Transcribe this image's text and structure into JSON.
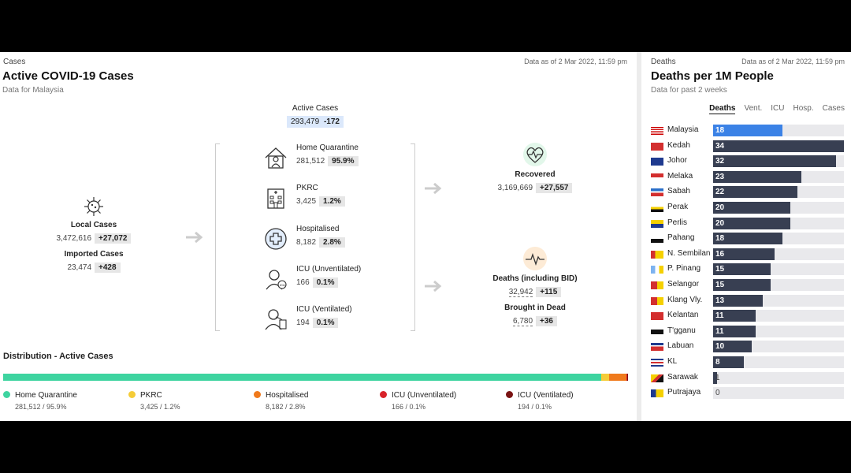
{
  "left_panel": {
    "section_label": "Cases",
    "timestamp": "Data as of 2 Mar 2022, 11:59 pm",
    "title": "Active COVID-19 Cases",
    "subtitle": "Data for Malaysia",
    "active_cases": {
      "label": "Active Cases",
      "value": "293,479",
      "delta": "-172"
    },
    "local_cases": {
      "label": "Local Cases",
      "value": "3,472,616",
      "delta": "+27,072"
    },
    "imported_cases": {
      "label": "Imported Cases",
      "value": "23,474",
      "delta": "+428"
    },
    "categories": [
      {
        "label": "Home Quarantine",
        "value": "281,512",
        "pct": "95.9%",
        "icon": "home-quarantine-icon"
      },
      {
        "label": "PKRC",
        "value": "3,425",
        "pct": "1.2%",
        "icon": "pkrc-building-icon"
      },
      {
        "label": "Hospitalised",
        "value": "8,182",
        "pct": "2.8%",
        "icon": "hospital-cross-icon"
      },
      {
        "label": "ICU (Unventilated)",
        "value": "166",
        "pct": "0.1%",
        "icon": "icu-doctor-icon"
      },
      {
        "label": "ICU (Ventilated)",
        "value": "194",
        "pct": "0.1%",
        "icon": "icu-ventilator-icon"
      }
    ],
    "recovered": {
      "label": "Recovered",
      "value": "3,169,669",
      "delta": "+27,557",
      "icon": "heartbeat-icon"
    },
    "deaths": {
      "label": "Deaths (including BID)",
      "value": "32,942",
      "delta": "+115",
      "icon": "pulse-icon"
    },
    "bid": {
      "label": "Brought in Dead",
      "value": "6,780",
      "delta": "+36"
    },
    "distribution": {
      "title": "Distribution - Active Cases",
      "segments": [
        {
          "name": "Home Quarantine",
          "text": "281,512 / 95.9%",
          "pct": 95.9,
          "color": "#3ed4a0"
        },
        {
          "name": "PKRC",
          "text": "3,425 / 1.2%",
          "pct": 1.2,
          "color": "#f5cc38"
        },
        {
          "name": "Hospitalised",
          "text": "8,182 / 2.8%",
          "pct": 2.8,
          "color": "#f07a1c"
        },
        {
          "name": "ICU (Unventilated)",
          "text": "166 / 0.1%",
          "pct": 0.1,
          "color": "#d8232a"
        },
        {
          "name": "ICU (Ventilated)",
          "text": "194 / 0.1%",
          "pct": 0.1,
          "color": "#7a1414"
        }
      ]
    }
  },
  "right_panel": {
    "section_label": "Deaths",
    "timestamp": "Data as of 2 Mar 2022, 11:59 pm",
    "title": "Deaths per 1M People",
    "subtitle": "Data for past 2 weeks",
    "tabs": [
      "Deaths",
      "Vent.",
      "ICU",
      "Hosp.",
      "Cases"
    ],
    "active_tab": "Deaths",
    "max_value": 34,
    "highlight_color": "#3b82e6",
    "bar_color": "#383f52",
    "states": [
      {
        "name": "Malaysia",
        "value": 18
      },
      {
        "name": "Kedah",
        "value": 34
      },
      {
        "name": "Johor",
        "value": 32
      },
      {
        "name": "Melaka",
        "value": 23
      },
      {
        "name": "Sabah",
        "value": 22
      },
      {
        "name": "Perak",
        "value": 20
      },
      {
        "name": "Perlis",
        "value": 20
      },
      {
        "name": "Pahang",
        "value": 18
      },
      {
        "name": "N. Sembilan",
        "value": 16
      },
      {
        "name": "P. Pinang",
        "value": 15
      },
      {
        "name": "Selangor",
        "value": 15
      },
      {
        "name": "Klang Vly.",
        "value": 13
      },
      {
        "name": "Kelantan",
        "value": 11
      },
      {
        "name": "T'gganu",
        "value": 11
      },
      {
        "name": "Labuan",
        "value": 10
      },
      {
        "name": "KL",
        "value": 8
      },
      {
        "name": "Sarawak",
        "value": 1
      },
      {
        "name": "Putrajaya",
        "value": 0
      }
    ]
  }
}
